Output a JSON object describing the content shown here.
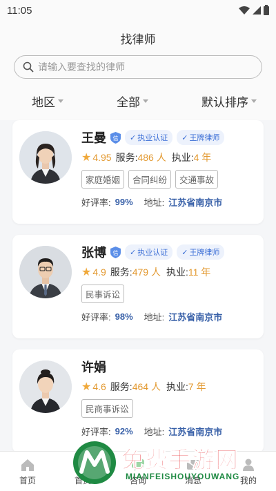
{
  "status_bar": {
    "time": "11:05"
  },
  "header": {
    "title": "找律师"
  },
  "search": {
    "placeholder": "请输入要查找的律师"
  },
  "filters": [
    {
      "label": "地区"
    },
    {
      "label": "全部"
    },
    {
      "label": "默认排序"
    }
  ],
  "lawyers": [
    {
      "name": "王曼",
      "badges": [
        "执业认证",
        "王牌律师"
      ],
      "rating": "4.95",
      "service_label": "服务:",
      "service_value": "486 人",
      "practice_label": "执业:",
      "practice_value": "4 年",
      "categories": [
        "家庭婚姻",
        "合同纠纷",
        "交通事故"
      ],
      "praise_label": "好评率:",
      "praise_value": "99%",
      "address_label": "地址:",
      "address_value": "江苏省南京市"
    },
    {
      "name": "张博",
      "badges": [
        "执业认证",
        "王牌律师"
      ],
      "rating": "4.9",
      "service_label": "服务:",
      "service_value": "479 人",
      "practice_label": "执业:",
      "practice_value": "11 年",
      "categories": [
        "民事诉讼"
      ],
      "praise_label": "好评率:",
      "praise_value": "98%",
      "address_label": "地址:",
      "address_value": "江苏省南京市"
    },
    {
      "name": "许娟",
      "rating": "4.6",
      "service_label": "服务:",
      "service_value": "464 人",
      "practice_label": "执业:",
      "practice_value": "7 年",
      "categories": [
        "民商事诉讼"
      ],
      "praise_label": "好评率:",
      "praise_value": "92%",
      "address_label": "地址:",
      "address_value": "江苏省南京市"
    }
  ],
  "bottom_nav": [
    {
      "label": "首页",
      "icon": "home-icon"
    },
    {
      "label": "首页",
      "icon": "lawyer-icon"
    },
    {
      "label": "咨询",
      "icon": "chat-icon"
    },
    {
      "label": "消息",
      "icon": "message-icon"
    },
    {
      "label": "我的",
      "icon": "profile-icon"
    }
  ],
  "watermark": {
    "text": "免费手游网",
    "sub": "MIANFEISHOUYOUWANG",
    "colors": {
      "text": "#e8383d",
      "sub": "#1f8a43"
    }
  },
  "colors": {
    "accent": "#3c6fd6",
    "highlight": "#e39a32",
    "star": "#f0a93b",
    "address": "#3860a8"
  }
}
